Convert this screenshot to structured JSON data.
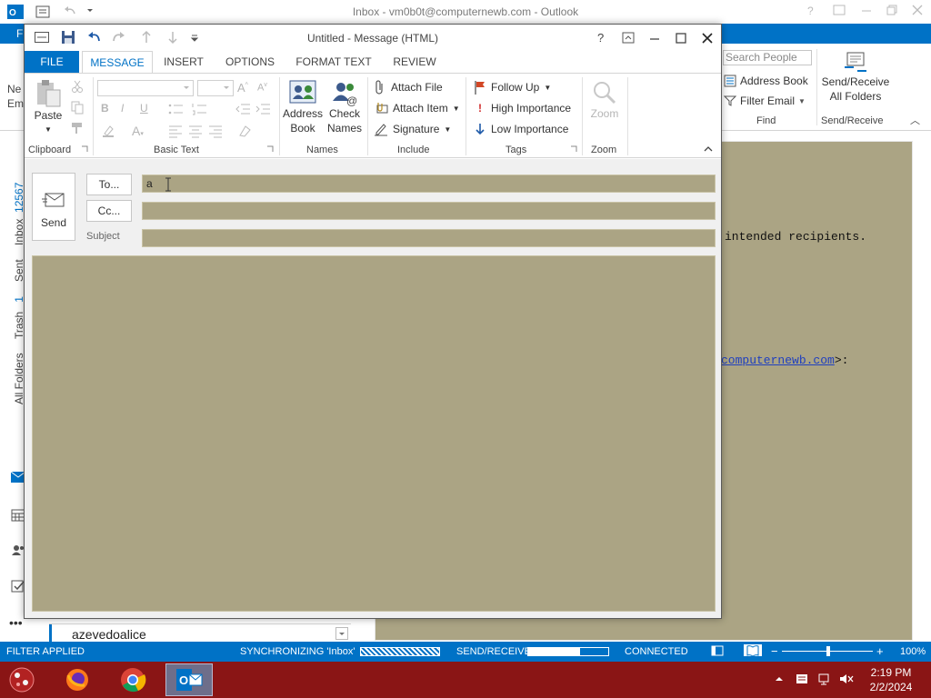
{
  "background_window": {
    "title": "Inbox - vm0b0t@computernewb.com - Outlook",
    "file_letter": "F",
    "left_stub": [
      "Ne",
      "Em"
    ],
    "search_people_placeholder": "Search People",
    "address_book": "Address Book",
    "filter_email": "Filter Email",
    "find_group": "Find",
    "send_receive_line1": "Send/Receive",
    "send_receive_line2": "All Folders",
    "send_receive_group": "Send/Receive",
    "nav": {
      "inbox": "Inbox",
      "inbox_count": "12567",
      "sent": "Sent",
      "trash": "Trash",
      "trash_count": "1",
      "all_folders": "All Folders"
    },
    "folder_field_value": "azevedoalice",
    "reading_lines": {
      "line1": "intended recipients.",
      "line2_link": "computernewb.com",
      "line2_suffix": ">:"
    }
  },
  "message_window": {
    "title": "Untitled - Message (HTML)",
    "tabs": [
      "FILE",
      "MESSAGE",
      "INSERT",
      "OPTIONS",
      "FORMAT TEXT",
      "REVIEW"
    ],
    "active_tab": "MESSAGE",
    "ribbon": {
      "paste": "Paste",
      "clipboard": "Clipboard",
      "basic_text": "Basic Text",
      "address_book_line1": "Address",
      "address_book_line2": "Book",
      "check_names_line1": "Check",
      "check_names_line2": "Names",
      "names": "Names",
      "attach_file": "Attach File",
      "attach_item": "Attach Item",
      "signature": "Signature",
      "include": "Include",
      "follow_up": "Follow Up",
      "high_importance": "High Importance",
      "low_importance": "Low Importance",
      "tags": "Tags",
      "zoom_btn": "Zoom",
      "zoom_group": "Zoom"
    },
    "send": "Send",
    "to_button": "To...",
    "cc_button": "Cc...",
    "subject_label": "Subject",
    "to_value": "a",
    "cc_value": "",
    "subject_value": ""
  },
  "statusbar": {
    "filter": "FILTER APPLIED",
    "syncing": "SYNCHRONIZING  'Inbox'",
    "send_receive": "SEND/RECEIVE",
    "send_receive_progress": 0.65,
    "connected": "CONNECTED",
    "zoom": "100%"
  },
  "taskbar": {
    "time": "2:19 PM",
    "date": "2/2/2024"
  },
  "colors": {
    "accent": "#0072c6",
    "field_bg": "#aba484",
    "taskbar": "#8a1515"
  }
}
